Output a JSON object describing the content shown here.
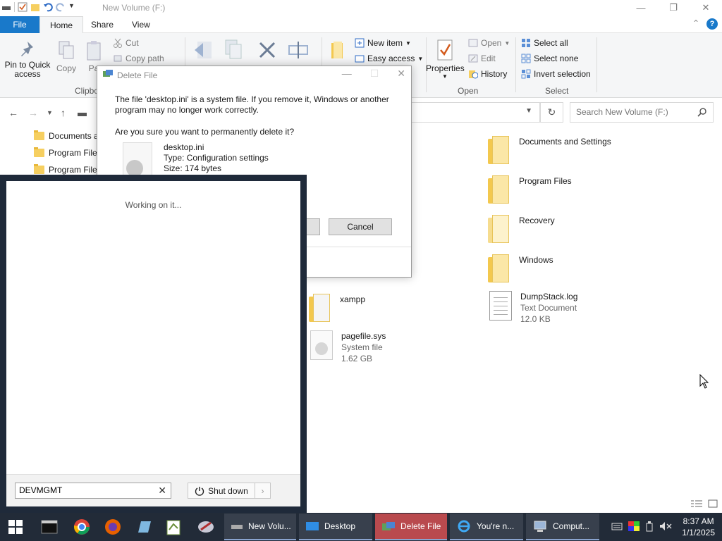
{
  "window": {
    "title": "New Volume (F:)",
    "minimize": "—",
    "maximize": "❐",
    "close": "✕"
  },
  "ribbon": {
    "tabs": [
      "File",
      "Home",
      "Share",
      "View"
    ],
    "clipboard": {
      "pin_label": "Pin to Quick access",
      "copy_label": "Copy",
      "paste_label": "Pa",
      "cut_label": "Cut",
      "copy_path_label": "Copy path",
      "group_label": "Clipbo"
    },
    "new": {
      "new_item_label": "New item",
      "easy_access_label": "Easy access"
    },
    "open": {
      "properties_label": "Properties",
      "open_label": "Open",
      "edit_label": "Edit",
      "history_label": "History",
      "group_label": "Open"
    },
    "select": {
      "select_all_label": "Select all",
      "select_none_label": "Select none",
      "invert_label": "Invert selection",
      "group_label": "Select"
    }
  },
  "search": {
    "placeholder": "Search New Volume (F:)"
  },
  "nav_pane": {
    "items": [
      "Documents a",
      "Program File",
      "Program File"
    ]
  },
  "files": [
    {
      "name": "Documents and Settings"
    },
    {
      "name": "Program Files"
    },
    {
      "name": "Recovery"
    },
    {
      "name": "Windows"
    },
    {
      "name": "DumpStack.log",
      "type": "Text Document",
      "size": "12.0 KB"
    },
    {
      "name": "xampp"
    },
    {
      "name": "pagefile.sys",
      "type": "System file",
      "size": "1.62 GB"
    }
  ],
  "dialog": {
    "title": "Delete File",
    "message": "The file 'desktop.ini' is a system file. If you remove it, Windows or another program may no longer work correctly.",
    "question": "Are you sure you want to permanently delete it?",
    "file_name": "desktop.ini",
    "file_type": "Type: Configuration settings",
    "file_size": "Size: 174 bytes",
    "cancel_label": "Cancel"
  },
  "run_panel": {
    "status": "Working on it...",
    "input_value": "DEVMGMT",
    "clear_icon": "✕",
    "shutdown_label": "Shut down"
  },
  "taskbar": {
    "tasks": [
      "New Volu...",
      "Desktop",
      "Delete File",
      "You're n...",
      "Comput..."
    ],
    "time": "8:37 AM",
    "date": "1/1/2025"
  }
}
